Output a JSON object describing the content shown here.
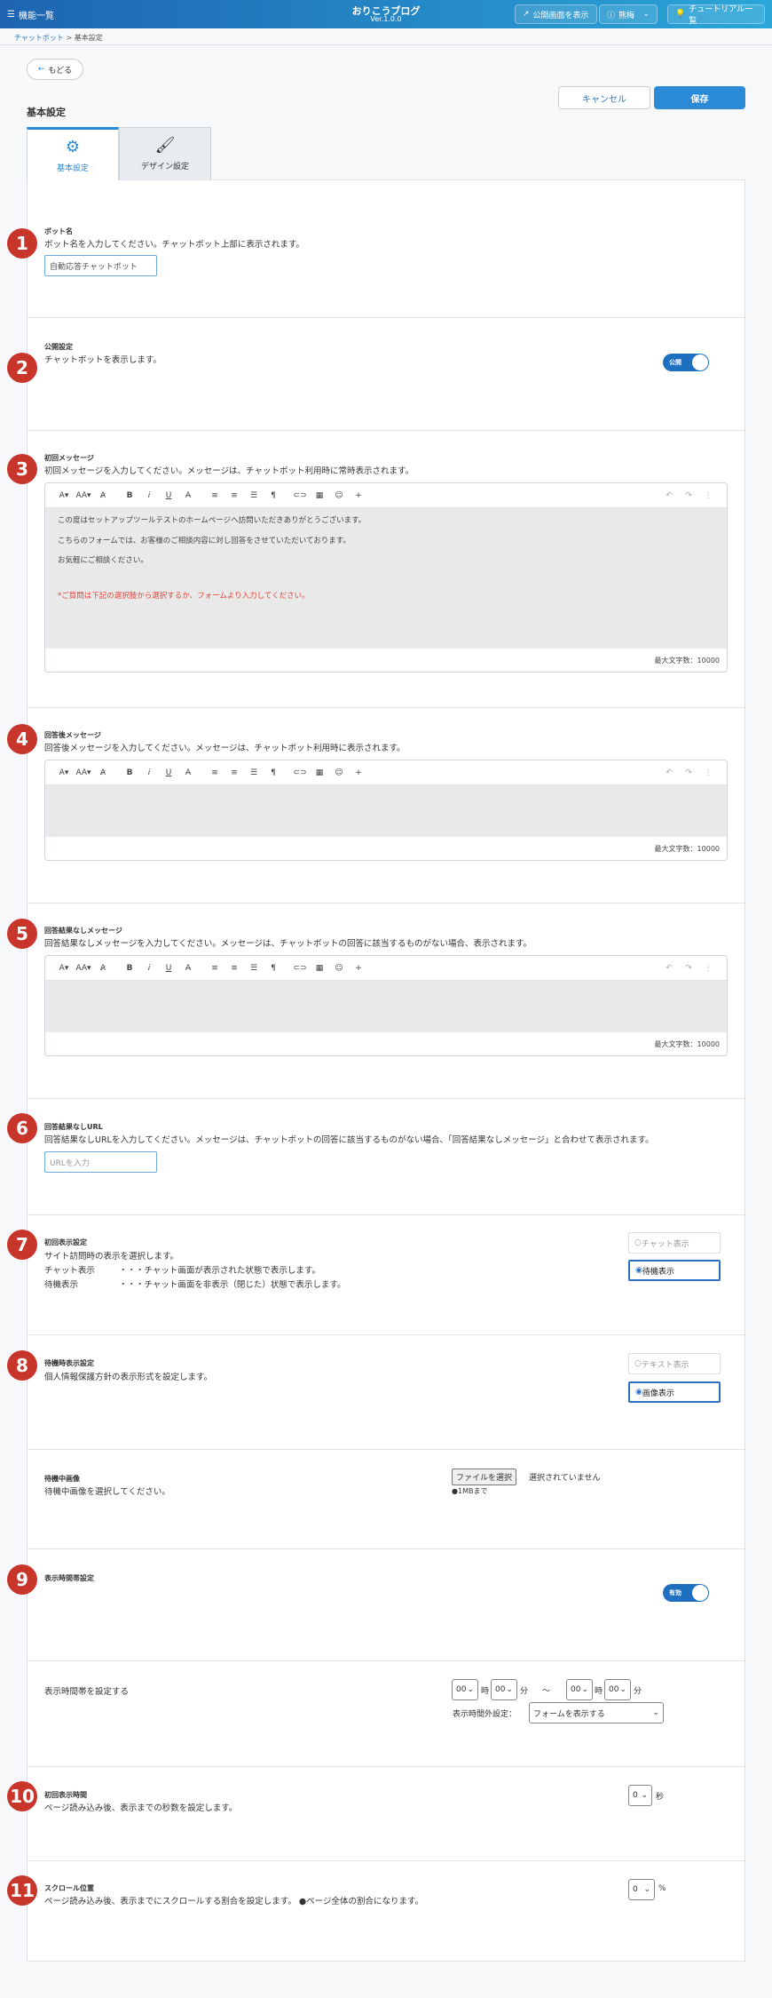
{
  "header": {
    "menu": "機能一覧",
    "title": "おりこうブログ",
    "version": "Ver.1.0.0",
    "preview": "公開画面を表示",
    "user": "熊梅",
    "tutorial": "チュートリアル一覧"
  },
  "breadcrumb": {
    "parent": "チャットボット",
    "sep": " > ",
    "current": "基本設定"
  },
  "back": "もどる",
  "page_title": "基本設定",
  "cancel": "キャンセル",
  "save": "保存",
  "tabs": [
    {
      "label": "基本設定"
    },
    {
      "label": "デザイン設定"
    }
  ],
  "numbers": [
    "1",
    "2",
    "3",
    "4",
    "5",
    "6",
    "7",
    "8",
    "9",
    "10",
    "11"
  ],
  "sections": {
    "bot_name": {
      "label": "ボット名",
      "desc": "ボット名を入力してください。チャットボット上部に表示されます。",
      "value": "自動応答チャットボット"
    },
    "publish": {
      "label": "公開設定",
      "desc": "チャットボットを表示します。",
      "toggle": "公開"
    },
    "first_msg": {
      "label": "初回メッセージ",
      "desc": "初回メッセージを入力してください。メッセージは、チャットボット利用時に常時表示されます。",
      "lines": [
        "この度はセットアップツールテストのホームページへ訪問いただきありがとうございます。",
        "こちらのフォームでは、お客様のご相談内容に対し回答をさせていただいております。",
        "お気軽にご相談ください。"
      ],
      "red": "*ご質問は下記の選択肢から選択するか、フォームより入力してください。",
      "counter": "最大文字数：10000"
    },
    "after_msg": {
      "label": "回答後メッセージ",
      "desc": "回答後メッセージを入力してください。メッセージは、チャットボット利用時に表示されます。",
      "counter": "最大文字数：10000"
    },
    "noresult_msg": {
      "label": "回答結果なしメッセージ",
      "desc": "回答結果なしメッセージを入力してください。メッセージは、チャットボットの回答に該当するものがない場合、表示されます。",
      "counter": "最大文字数：10000"
    },
    "noresult_url": {
      "label": "回答結果なしURL",
      "desc": "回答結果なしURLを入力してください。メッセージは、チャットボットの回答に該当するものがない場合、「回答結果なしメッセージ」と合わせて表示されます。",
      "placeholder": "URLを入力"
    },
    "initial_display": {
      "label": "初回表示設定",
      "desc": "サイト訪問時の表示を選択します。",
      "line1a": "チャット表示",
      "line1b": "・・・チャット画面が表示された状態で表示します。",
      "line2a": "待機表示",
      "line2b": "・・・チャット画面を非表示（閉じた）状態で表示します。",
      "opt1": "チャット表示",
      "opt2": "待機表示"
    },
    "standby_display": {
      "label": "待機時表示設定",
      "desc": "個人情報保護方針の表示形式を設定します。",
      "opt1": "テキスト表示",
      "opt2": "画像表示"
    },
    "standby_image": {
      "label": "待機中画像",
      "desc": "待機中画像を選択してください。",
      "file_btn": "ファイルを選択",
      "file_status": "選択されていません",
      "note": "●1MBまで"
    },
    "display_time": {
      "label": "表示時間帯設定",
      "toggle": "有効"
    },
    "time_range": {
      "label": "表示時間帯を設定する",
      "h1": "00",
      "m1": "00",
      "h2": "00",
      "m2": "00",
      "hour": "時",
      "min": "分",
      "tilde": "〜",
      "outside_label": "表示時間外設定：",
      "outside_value": "フォームを表示する"
    },
    "initial_time": {
      "label": "初回表示時間",
      "desc": "ページ読み込み後、表示までの秒数を設定します。",
      "value": "0",
      "unit": "秒"
    },
    "scroll": {
      "label": "スクロール位置",
      "desc": "ページ読み込み後、表示までにスクロールする割合を設定します。 ●ページ全体の割合になります。",
      "value": "0",
      "unit": "%"
    }
  }
}
